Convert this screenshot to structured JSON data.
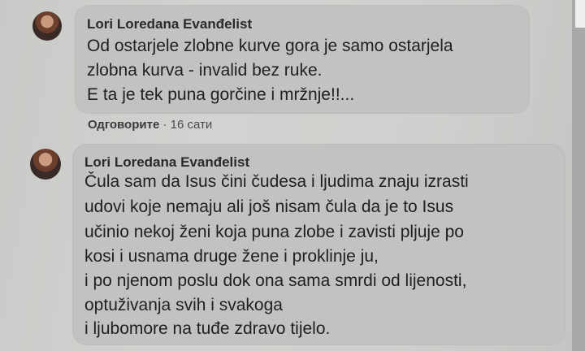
{
  "comments": [
    {
      "author": "Lori Loredana Evanđelist",
      "lines": [
        "Od ostarjele zlobne kurve gora je samo ostarjela",
        "zlobna kurva - invalid bez ruke.",
        "E ta je tek puna gorčine i mržnje!!..."
      ],
      "reply_label": "Одговорите",
      "separator": " · ",
      "timestamp": "16 сати"
    },
    {
      "author": "Lori Loredana Evanđelist",
      "lines": [
        "Čula sam da Isus čini čudesa i ljudima znaju izrasti",
        "udovi koje nemaju ali još nisam čula da je to Isus",
        "učinio nekoj ženi koja puna zlobe i zavisti pljuje po",
        "kosi i usnama druge žene i proklinje ju,",
        "i po njenom poslu dok ona sama smrdi od lijenosti,",
        "optuživanja svih i svakoga",
        "i ljubomore na tuđe zdravo tijelo."
      ]
    }
  ]
}
